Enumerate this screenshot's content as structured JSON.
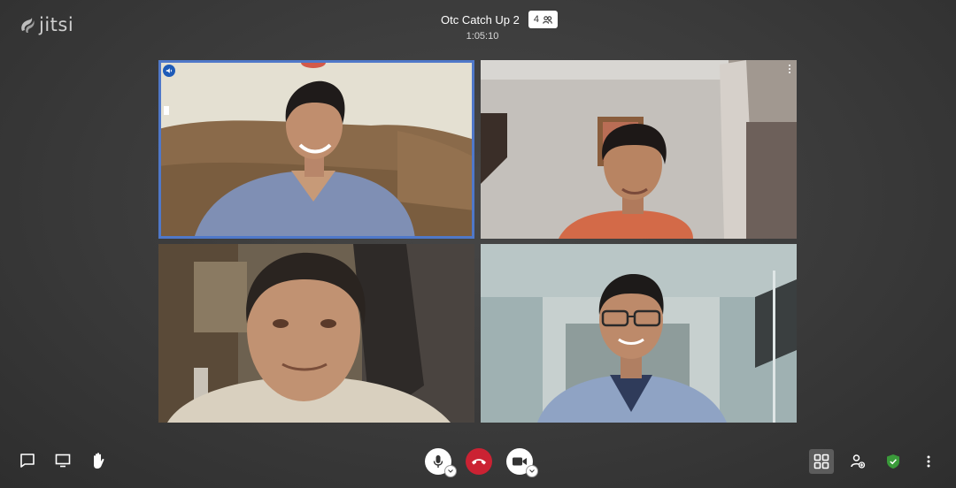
{
  "app": {
    "name": "jitsi"
  },
  "header": {
    "title": "Otc Catch Up 2",
    "participant_count": "4",
    "duration": "1:05:10"
  },
  "tiles": [
    {
      "id": "tile-1",
      "dominant_speaker": true,
      "icon": "speaker-icon"
    },
    {
      "id": "tile-2",
      "dominant_speaker": false,
      "icon": "more-vertical-icon"
    },
    {
      "id": "tile-3",
      "dominant_speaker": false
    },
    {
      "id": "tile-4",
      "dominant_speaker": false
    }
  ],
  "toolbar": {
    "left": [
      "chat-icon",
      "screen-share-icon",
      "raise-hand-icon"
    ],
    "center": [
      "microphone-icon",
      "hangup-icon",
      "camera-icon"
    ],
    "right": [
      "tile-view-icon",
      "invite-icon",
      "security-shield-icon",
      "more-options-icon"
    ]
  },
  "colors": {
    "hangup": "#cb2233",
    "active_speaker_border": "#4f78c9",
    "security_shield": "#3a9a3a",
    "background": "#3a3a3a"
  }
}
